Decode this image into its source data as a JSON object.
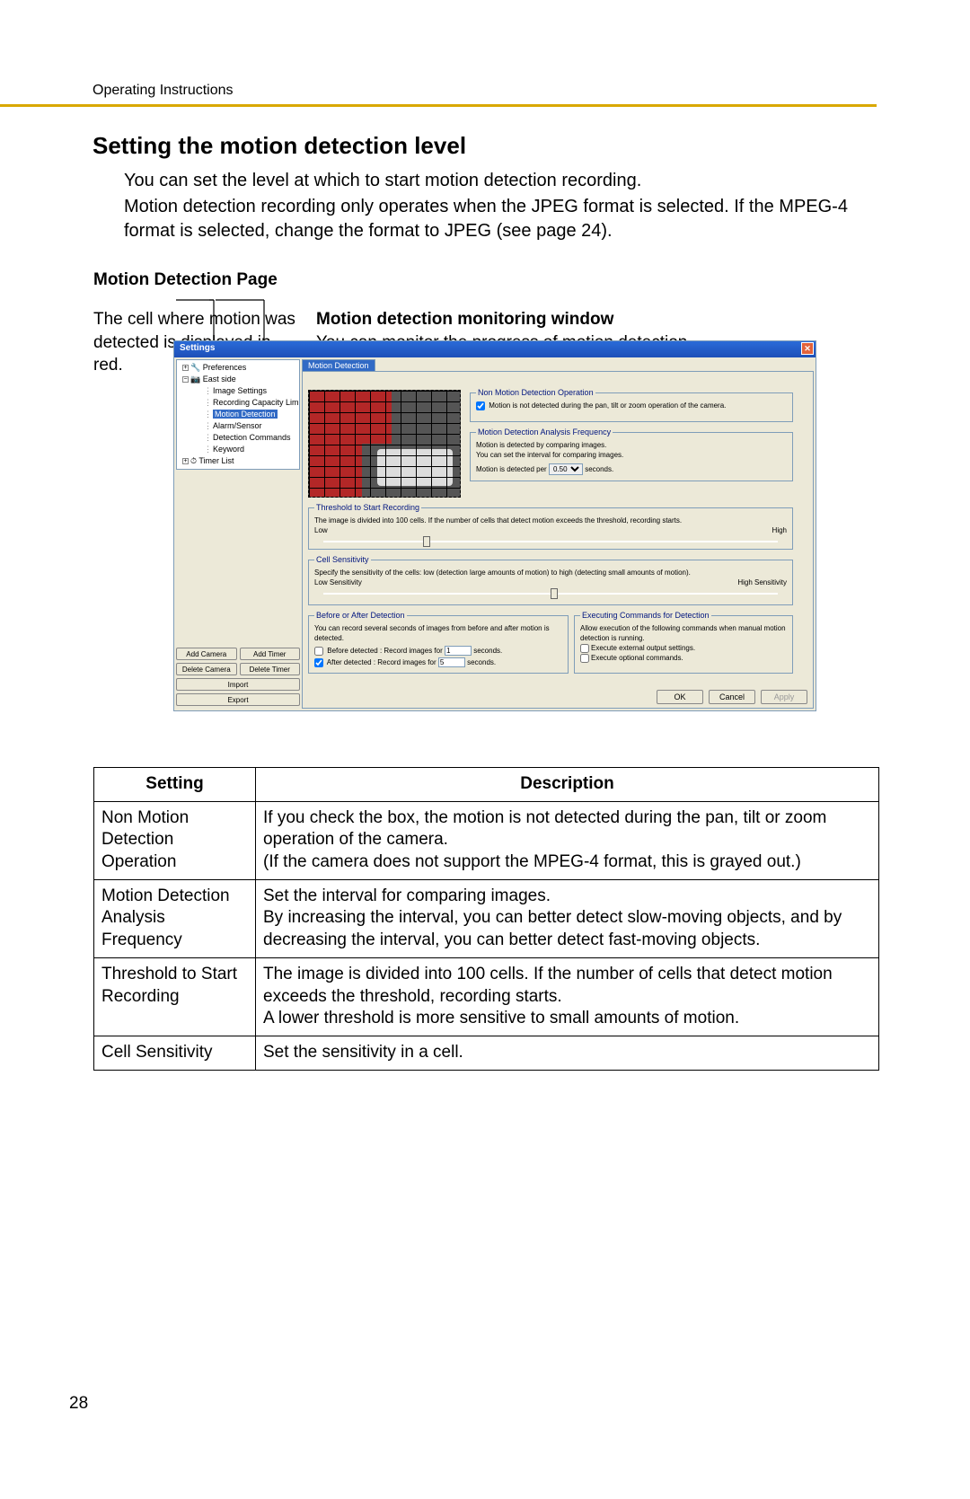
{
  "header": {
    "running": "Operating Instructions"
  },
  "title": "Setting the motion detection level",
  "para1": "You can set the level at which to start motion detection recording.",
  "para2": "Motion detection recording only operates when the JPEG format is selected. If the MPEG-4 format is selected, change the format to JPEG (see page 24).",
  "section_motion_page": "Motion Detection Page",
  "callout_left": "The cell where motion was detected is displayed in red.",
  "callout_right_title": "Motion detection monitoring window",
  "callout_right_body": "You can monitor the progress of motion detection.",
  "page_number": "28",
  "settings_window": {
    "title": "Settings",
    "tree": {
      "preferences": "Preferences",
      "east_side": "East side",
      "image_settings": "Image Settings",
      "rec_capacity": "Recording Capacity Limit",
      "motion_detection": "Motion Detection",
      "alarm_sensor": "Alarm/Sensor",
      "detection_commands": "Detection Commands",
      "keyword": "Keyword",
      "timer_list": "Timer List"
    },
    "buttons": {
      "add_camera": "Add Camera",
      "add_timer": "Add Timer",
      "delete_camera": "Delete Camera",
      "delete_timer": "Delete Timer",
      "import": "Import",
      "export": "Export"
    },
    "tab": "Motion Detection",
    "groups": {
      "non_motion": {
        "legend": "Non Motion Detection Operation",
        "checkbox_label": "Motion is not detected during the pan, tilt or zoom operation of the camera.",
        "checked": true
      },
      "analysis_freq": {
        "legend": "Motion Detection Analysis Frequency",
        "line1": "Motion is detected by comparing images.",
        "line2": "You can set the interval for comparing images.",
        "line3_pre": "Motion is detected per",
        "value": "0.50",
        "line3_post": "seconds."
      },
      "threshold": {
        "legend": "Threshold to Start Recording",
        "hint": "The image is divided into 100 cells. If the number of cells that detect motion exceeds the threshold, recording starts.",
        "low": "Low",
        "high": "High",
        "pos_percent": 22
      },
      "cell_sens": {
        "legend": "Cell Sensitivity",
        "hint": "Specify the sensitivity of the cells: low (detection large amounts of motion) to high (detecting small amounts of motion).",
        "low": "Low Sensitivity",
        "high": "High Sensitivity",
        "pos_percent": 50
      },
      "before_after": {
        "legend": "Before or After Detection",
        "hint": "You can record several seconds of images from before and after motion is detected.",
        "before_label": "Before detected : Record images for",
        "before_checked": false,
        "before_value": "1",
        "after_label": "After detected : Record images for",
        "after_checked": true,
        "after_value": "5",
        "seconds": "seconds."
      },
      "exec_cmds": {
        "legend": "Executing Commands for Detection",
        "hint": "Allow execution of the following commands when manual motion detection is running.",
        "opt1": "Execute external output settings.",
        "opt2": "Execute optional commands."
      }
    },
    "ok": "OK",
    "cancel": "Cancel",
    "apply": "Apply"
  },
  "table": {
    "head_setting": "Setting",
    "head_desc": "Description",
    "rows": [
      {
        "s": "Non Motion Detection Operation",
        "d": "If you check the box, the motion is not detected during the pan, tilt or zoom operation of the camera.\n(If the camera does not support the MPEG-4 format, this is grayed out.)"
      },
      {
        "s": "Motion Detection Analysis Frequency",
        "d": "Set the interval for comparing images.\nBy increasing the interval, you can better detect slow-moving objects, and by decreasing the interval, you can better detect fast-moving objects."
      },
      {
        "s": "Threshold to Start Recording",
        "d": "The image is divided into 100 cells. If the number of cells that detect motion exceeds the threshold, recording starts.\nA lower threshold is more sensitive to small amounts of motion."
      },
      {
        "s": "Cell Sensitivity",
        "d": "Set the sensitivity in a cell."
      }
    ]
  }
}
